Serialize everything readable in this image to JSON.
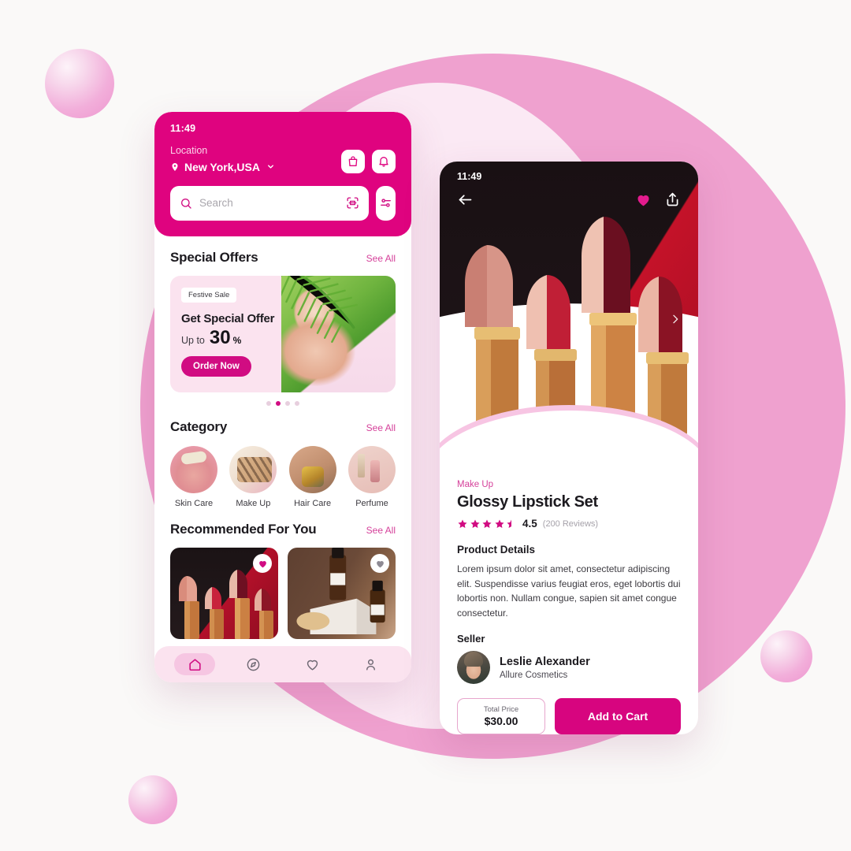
{
  "theme": {
    "brand_pink": "#DF037F",
    "accent_pink": "#D10C82",
    "soft_pink": "#FBE3EF",
    "bg_circle": "#EFA1CF",
    "bg_inner_circle": "#FBE9F4",
    "page_bg": "#FAF9F8"
  },
  "home": {
    "status_time": "11:49",
    "location_label": "Location",
    "location_value": "New York,USA",
    "icons": {
      "location_pin": "location-pin-icon",
      "chevron_down": "chevron-down-icon",
      "bag": "shopping-bag-icon",
      "bell": "notification-bell-icon",
      "search": "search-icon",
      "scan": "scan-icon",
      "filter": "filter-sliders-icon"
    },
    "search_placeholder": "Search",
    "search_value": "",
    "sections": {
      "special_offers": {
        "title": "Special Offers",
        "see_all": "See All"
      },
      "category": {
        "title": "Category",
        "see_all": "See All"
      },
      "recommended": {
        "title": "Recommended For You",
        "see_all": "See All"
      }
    },
    "offer": {
      "badge": "Festive Sale",
      "title": "Get Special Offer",
      "upto": "Up to",
      "amount": "30",
      "percent": "%",
      "button": "Order Now"
    },
    "carousel": {
      "total_dots": 4,
      "active_index": 1
    },
    "categories": [
      {
        "label": "Skin Care"
      },
      {
        "label": "Make Up"
      },
      {
        "label": "Hair Care"
      },
      {
        "label": "Perfume"
      }
    ],
    "recommended": [
      {
        "name": "lipstick-set-card",
        "favorited": true
      },
      {
        "name": "serum-bottle-card",
        "favorited": false
      }
    ],
    "nav": [
      {
        "label": "Home",
        "icon": "home-icon",
        "active": true
      },
      {
        "label": "Explore",
        "icon": "compass-icon",
        "active": false
      },
      {
        "label": "Favorites",
        "icon": "heart-icon",
        "active": false
      },
      {
        "label": "Profile",
        "icon": "person-icon",
        "active": false
      }
    ]
  },
  "detail": {
    "status_time": "11:49",
    "icons": {
      "back": "back-arrow-icon",
      "favorite": "heart-filled-icon",
      "share": "share-icon",
      "prev": "chevron-left-icon",
      "next": "chevron-right-icon"
    },
    "category": "Make Up",
    "title": "Glossy Lipstick Set",
    "rating": "4.5",
    "rating_stars": 4.5,
    "reviews": "(200 Reviews)",
    "details_heading": "Product Details",
    "description": "Lorem ipsum dolor sit amet, consectetur adipiscing elit. Suspendisse varius feugiat eros, eget lobortis dui lobortis non. Nullam congue, sapien sit amet congue consectetur.",
    "seller_heading": "Seller",
    "seller_name": "Leslie Alexander",
    "seller_company": "Allure Cosmetics",
    "price_label": "Total Price",
    "price_value": "$30.00",
    "cta": "Add to Cart"
  }
}
